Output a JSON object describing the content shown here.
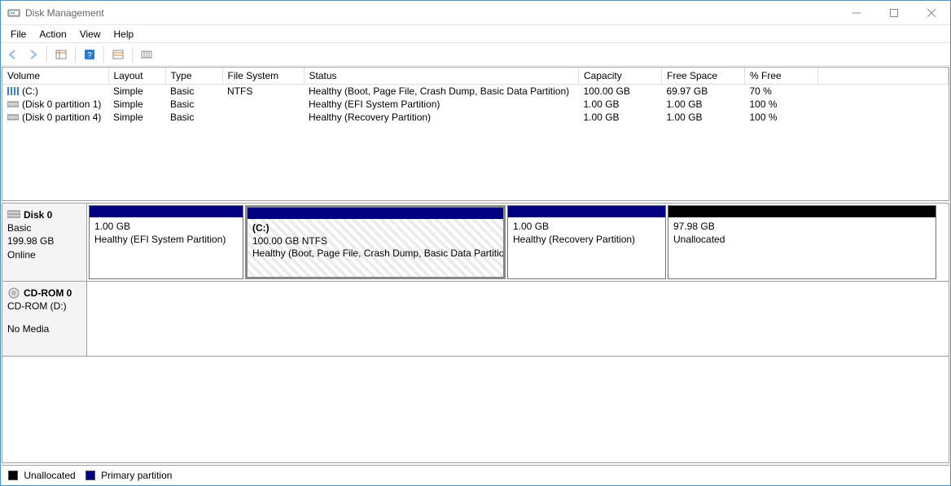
{
  "window": {
    "title": "Disk Management"
  },
  "menu": {
    "items": [
      "File",
      "Action",
      "View",
      "Help"
    ]
  },
  "toolbar": {
    "back": "back-icon",
    "forward": "forward-icon",
    "up": "properties-icon",
    "help": "help-icon",
    "refresh": "refresh-icon",
    "list": "list-icon"
  },
  "volumeTable": {
    "headers": [
      "Volume",
      "Layout",
      "Type",
      "File System",
      "Status",
      "Capacity",
      "Free Space",
      "% Free"
    ],
    "rows": [
      {
        "icon": "volume-stripe-icon",
        "volume": "(C:)",
        "layout": "Simple",
        "type": "Basic",
        "fs": "NTFS",
        "status": "Healthy (Boot, Page File, Crash Dump, Basic Data Partition)",
        "capacity": "100.00 GB",
        "free": "69.97 GB",
        "pct": "70 %"
      },
      {
        "icon": "volume-icon",
        "volume": "(Disk 0 partition 1)",
        "layout": "Simple",
        "type": "Basic",
        "fs": "",
        "status": "Healthy (EFI System Partition)",
        "capacity": "1.00 GB",
        "free": "1.00 GB",
        "pct": "100 %"
      },
      {
        "icon": "volume-icon",
        "volume": "(Disk 0 partition 4)",
        "layout": "Simple",
        "type": "Basic",
        "fs": "",
        "status": "Healthy (Recovery Partition)",
        "capacity": "1.00 GB",
        "free": "1.00 GB",
        "pct": "100 %"
      }
    ]
  },
  "disks": [
    {
      "icon": "disk-icon",
      "name": "Disk 0",
      "type": "Basic",
      "size": "199.98 GB",
      "status": "Online",
      "partitions": [
        {
          "stripClass": "primary",
          "selected": false,
          "flex": 190,
          "label": "",
          "line1": "1.00 GB",
          "line2": "Healthy (EFI System Partition)"
        },
        {
          "stripClass": "primary",
          "selected": true,
          "flex": 320,
          "label": "(C:)",
          "line1": "100.00 GB NTFS",
          "line2": "Healthy (Boot, Page File, Crash Dump, Basic Data Partition)"
        },
        {
          "stripClass": "primary",
          "selected": false,
          "flex": 195,
          "label": "",
          "line1": "1.00 GB",
          "line2": "Healthy (Recovery Partition)"
        },
        {
          "stripClass": "unalloc",
          "selected": false,
          "flex": 330,
          "label": "",
          "line1": "97.98 GB",
          "line2": "Unallocated"
        }
      ]
    },
    {
      "icon": "cdrom-icon",
      "name": "CD-ROM 0",
      "type": "CD-ROM (D:)",
      "size": "",
      "status": "No Media",
      "partitions": []
    }
  ],
  "legend": {
    "unallocated": "Unallocated",
    "primary": "Primary partition"
  }
}
